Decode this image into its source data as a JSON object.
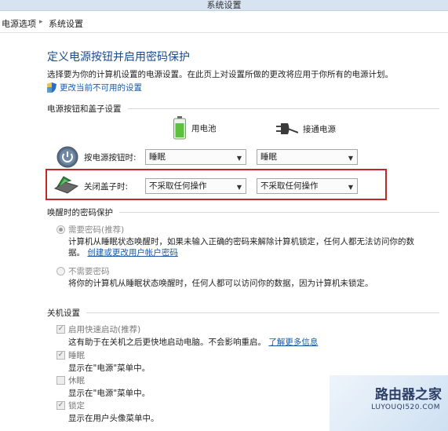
{
  "window": {
    "title": "系统设置"
  },
  "breadcrumb": {
    "items": [
      "电源选项",
      "系统设置"
    ],
    "separator": "▸"
  },
  "page": {
    "title": "定义电源按钮并启用密码保护",
    "subtitle": "选择要为你的计算机设置的电源设置。在此页上对设置所做的更改将应用于你所有的电源计划。",
    "change_link": "更改当前不可用的设置"
  },
  "power_section": {
    "heading": "电源按钮和盖子设置",
    "battery_label": "用电池",
    "plugged_label": "接通电源",
    "rows": [
      {
        "label": "按电源按钮时:",
        "battery_value": "睡眠",
        "plugged_value": "睡眠",
        "icon": "power-icon"
      },
      {
        "label": "关闭盖子时:",
        "battery_value": "不采取任何操作",
        "plugged_value": "不采取任何操作",
        "icon": "laptop-lid-icon"
      }
    ]
  },
  "password_section": {
    "heading": "唤醒时的密码保护",
    "require": {
      "label": "需要密码(推荐)",
      "selected": true,
      "desc1": "计算机从睡眠状态唤醒时，如果未输入正确的密码来解除计算机锁定，任何人都无法访问你的数",
      "desc2": "据。",
      "link": "创建或更改用户帐户密码"
    },
    "no_require": {
      "label": "不需要密码",
      "selected": false,
      "desc": "将你的计算机从睡眠状态唤醒时，任何人都可以访问你的数据，因为计算机未锁定。"
    }
  },
  "shutdown_section": {
    "heading": "关机设置",
    "items": [
      {
        "label": "启用快速启动(推荐)",
        "checked": true,
        "desc": "这有助于在关机之后更快地启动电脑。不会影响重启。",
        "link": "了解更多信息"
      },
      {
        "label": "睡眠",
        "checked": true,
        "desc": "显示在\"电源\"菜单中。"
      },
      {
        "label": "休眠",
        "checked": false,
        "desc": "显示在\"电源\"菜单中。"
      },
      {
        "label": "锁定",
        "checked": true,
        "desc": "显示在用户头像菜单中。"
      }
    ]
  },
  "watermark": {
    "text": "路由器之家",
    "url": "LUYOUQI520.COM"
  },
  "colors": {
    "title_blue": "#1a4a8c",
    "link_blue": "#1a5aa8",
    "highlight_red": "#c5262b"
  }
}
